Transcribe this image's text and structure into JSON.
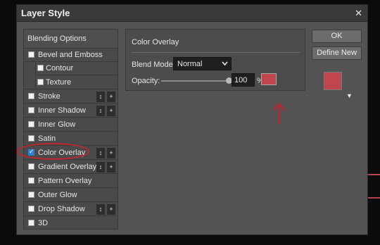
{
  "dialog": {
    "title": "Layer Style",
    "close_label": "✕"
  },
  "styles_list": {
    "header": "Blending Options",
    "items": [
      {
        "label": "Bevel and Emboss",
        "checked": false,
        "indent": 0
      },
      {
        "label": "Contour",
        "checked": false,
        "indent": 1
      },
      {
        "label": "Texture",
        "checked": false,
        "indent": 1
      },
      {
        "label": "Stroke",
        "checked": false,
        "indent": 0,
        "controls": true
      },
      {
        "label": "Inner Shadow",
        "checked": false,
        "indent": 0,
        "controls": true
      },
      {
        "label": "Inner Glow",
        "checked": false,
        "indent": 0
      },
      {
        "label": "Satin",
        "checked": false,
        "indent": 0
      },
      {
        "label": "Color Overlay",
        "checked": true,
        "indent": 0,
        "controls": true,
        "highlighted": true
      },
      {
        "label": "Gradient Overlay",
        "checked": false,
        "indent": 0,
        "controls": true
      },
      {
        "label": "Pattern Overlay",
        "checked": false,
        "indent": 0
      },
      {
        "label": "Outer Glow",
        "checked": false,
        "indent": 0
      },
      {
        "label": "Drop Shadow",
        "checked": false,
        "indent": 0,
        "controls": true
      },
      {
        "label": "3D",
        "checked": false,
        "indent": 0
      }
    ],
    "control_up_down": "↕",
    "control_add": "+"
  },
  "color_overlay": {
    "title": "Color Overlay",
    "blend_mode_label": "Blend Mode:",
    "blend_mode_value": "Normal",
    "opacity_label": "Opacity:",
    "opacity_value": "100",
    "opacity_unit": "%",
    "overlay_color": "#c0454d"
  },
  "buttons": {
    "ok": "OK",
    "define_new": "Define New"
  },
  "preview": {
    "swatch_color": "#c0454d",
    "dropdown_glyph": "▼"
  },
  "annotations": {
    "highlight_color": "#c3252d"
  }
}
